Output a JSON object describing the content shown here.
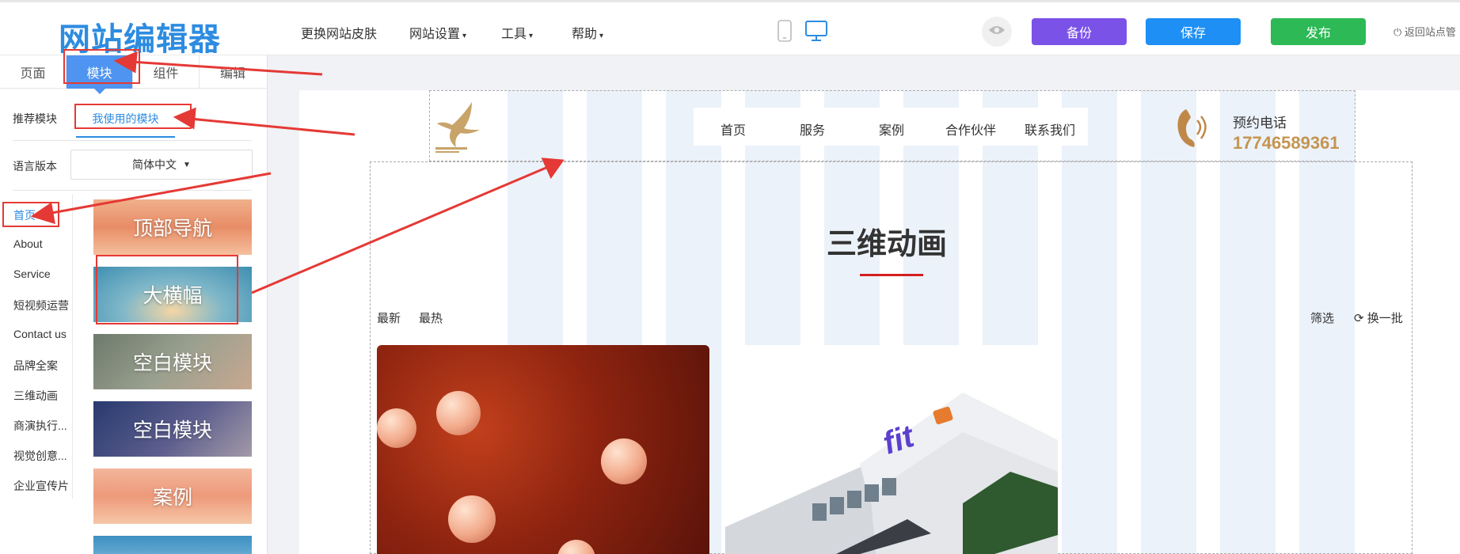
{
  "topbar": {
    "logo": "网站编辑器",
    "nav": [
      {
        "label": "更换网站皮肤",
        "caret": ""
      },
      {
        "label": "网站设置",
        "caret": "▾"
      },
      {
        "label": "工具",
        "caret": "▾"
      },
      {
        "label": "帮助",
        "caret": "▾"
      }
    ],
    "buttons": {
      "backup": "备份",
      "save": "保存",
      "publish": "发布"
    },
    "return_label": "返回站点管"
  },
  "colors": {
    "backup": "#7b52e8",
    "save": "#1e8ff5",
    "publish": "#2db955",
    "accent": "#4f94f0",
    "annotation": "#e53935"
  },
  "left_panel": {
    "tabs": [
      "页面",
      "模块",
      "组件",
      "编辑"
    ],
    "active_tab": "模块",
    "subtabs": {
      "recommended": "推荐模块",
      "mine": "我使用的模块"
    },
    "language": {
      "label": "语言版本",
      "value": "简体中文"
    },
    "pages": [
      "首页",
      "About",
      "Service",
      "短视频运营",
      "Contact us",
      "品牌全案",
      "三维动画",
      "商演执行...",
      "视觉创意...",
      "企业宣传片"
    ],
    "modules": [
      "顶部导航",
      "大横幅",
      "空白模块",
      "空白模块",
      "案例",
      ""
    ]
  },
  "site": {
    "nav": [
      "首页",
      "服务",
      "案例",
      "合作伙伴",
      "联系我们"
    ],
    "phone_label": "预约电话",
    "phone_number": "17746589361",
    "section_title": "三维动画",
    "filters": {
      "latest": "最新",
      "hottest": "最热",
      "screen": "筛选",
      "refresh": "换一批"
    },
    "card2_text": "fit"
  },
  "icons": [
    "mobile-icon",
    "desktop-icon",
    "eye-icon",
    "power-icon",
    "refresh-icon",
    "phone-icon",
    "hummingbird-logo-icon"
  ]
}
